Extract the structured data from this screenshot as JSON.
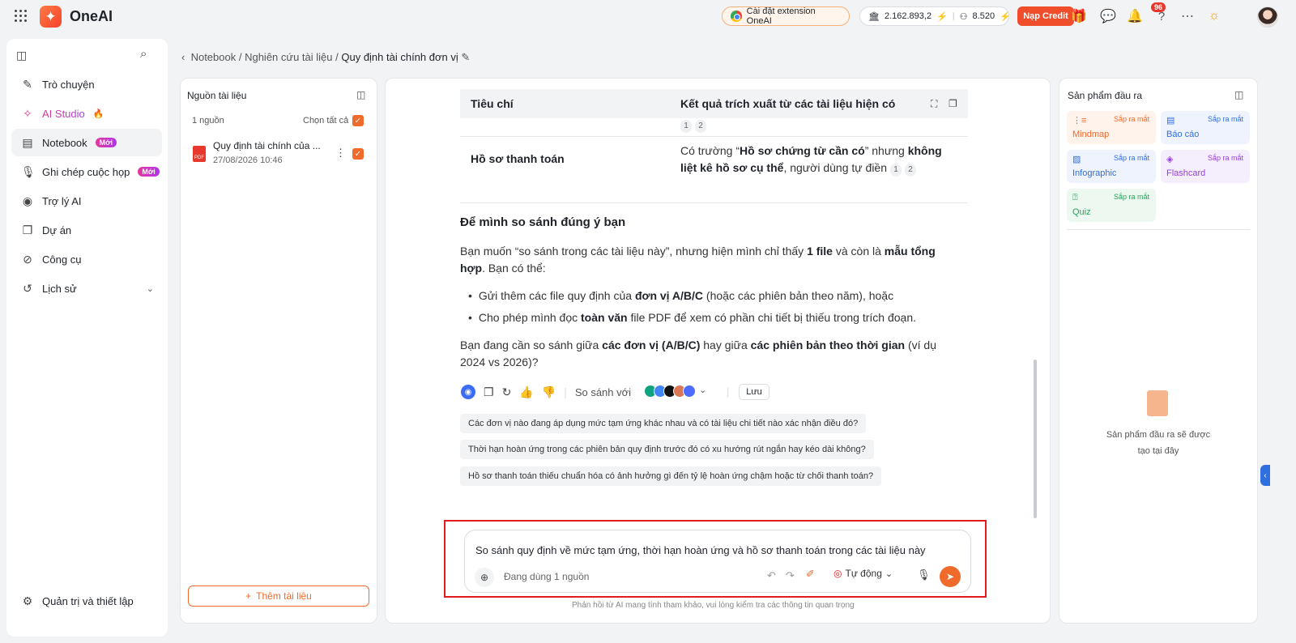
{
  "app": {
    "name": "OneAI"
  },
  "topbar": {
    "extension_label": "Cài đặt extension OneAI",
    "credits": "2.162.893,2",
    "users": "8.520",
    "topup_label": "Nạp Credit",
    "notification_count": "96"
  },
  "sidebar": {
    "items": [
      {
        "label": "Trò chuyện",
        "icon": "chat-edit-icon"
      },
      {
        "label": "AI Studio",
        "icon": "sparkle-icon"
      },
      {
        "label": "Notebook",
        "icon": "notebook-icon",
        "badge": "Mới"
      },
      {
        "label": "Ghi chép cuộc họp",
        "icon": "mic-icon",
        "badge": "Mới"
      },
      {
        "label": "Trợ lý AI",
        "icon": "robot-icon"
      },
      {
        "label": "Dự án",
        "icon": "folder-icon"
      },
      {
        "label": "Công cụ",
        "icon": "compass-icon"
      },
      {
        "label": "Lịch sử",
        "icon": "history-icon"
      }
    ],
    "settings_label": "Quản trị và thiết lập"
  },
  "breadcrumb": {
    "part1": "Notebook",
    "part2": "Nghiên cứu tài liệu",
    "current": "Quy định tài chính đơn vị"
  },
  "sources": {
    "title": "Nguồn tài liệu",
    "count_label": "1 nguồn",
    "select_all_label": "Chọn tất cả",
    "file_name": "Quy định tài chính của ...",
    "file_date": "27/08/2026 10:46",
    "add_label": "Thêm tài liệu"
  },
  "chat": {
    "table": {
      "col1": "Tiêu chí",
      "col2": "Kết quả trích xuất từ các tài liệu hiện có",
      "row_label": "Hồ sơ thanh toán",
      "row_text_1": "Có trường “",
      "row_bold_1": "Hồ sơ chứng từ cần có",
      "row_text_2": "” nhưng ",
      "row_bold_2": "không liệt kê hồ sơ cụ thể",
      "row_text_3": ", người dùng tự điền",
      "cite_1": "1",
      "cite_2": "2"
    },
    "heading": "Để mình so sánh đúng ý bạn",
    "para1_a": "Bạn muốn “so sánh trong các tài liệu này”, nhưng hiện mình chỉ thấy ",
    "para1_b": "1 file",
    "para1_c": " và còn là ",
    "para1_d": "mẫu tổng hợp",
    "para1_e": ". Bạn có thể:",
    "bullet1_a": "Gửi thêm các file quy định của ",
    "bullet1_b": "đơn vị A/B/C",
    "bullet1_c": " (hoặc các phiên bản theo năm), hoặc",
    "bullet2_a": "Cho phép mình đọc ",
    "bullet2_b": "toàn văn",
    "bullet2_c": " file PDF để xem có phần chi tiết bị thiếu trong trích đoạn.",
    "para2_a": "Bạn đang cần so sánh giữa ",
    "para2_b": "các đơn vị (A/B/C)",
    "para2_c": " hay giữa ",
    "para2_d": "các phiên bản theo thời gian",
    "para2_e": " (ví dụ 2024 vs 2026)?",
    "compare_label": "So sánh với",
    "save_label": "Lưu",
    "suggestions": [
      "Các đơn vị nào đang áp dụng mức tạm ứng khác nhau và có tài liệu chi tiết nào xác nhận điều đó?",
      "Thời hạn hoàn ứng trong các phiên bản quy định trước đó có xu hướng rút ngắn hay kéo dài không?",
      "Hồ sơ thanh toán thiếu chuẩn hóa có ảnh hưởng gì đến tỷ lệ hoàn ứng chậm hoặc từ chối thanh toán?"
    ],
    "input_value": "So sánh quy định về mức tạm ứng, thời hạn hoàn ứng và hồ sơ thanh toán trong các tài liệu này",
    "source_usage": "Đang dùng 1 nguồn",
    "mode_label": "Tự động",
    "disclaimer": "Phản hồi từ AI mang tính tham khảo, vui lòng kiểm tra các thông tin quan trọng"
  },
  "output": {
    "title": "Sản phẩm đầu ra",
    "soon_label": "Sắp ra mắt",
    "tiles": [
      {
        "label": "Mindmap",
        "color": "#f06a2c",
        "bg": "#fff3ec"
      },
      {
        "label": "Báo cáo",
        "color": "#2f6fe0",
        "bg": "#eef3fd"
      },
      {
        "label": "Infographic",
        "color": "#2f6fe0",
        "bg": "#eef3fd"
      },
      {
        "label": "Flashcard",
        "color": "#9b3de0",
        "bg": "#f5eefd"
      },
      {
        "label": "Quiz",
        "color": "#27a35a",
        "bg": "#ecf8f0"
      }
    ],
    "empty_line1": "Sản phẩm đầu ra sẽ được",
    "empty_line2": "tạo tại đây"
  }
}
